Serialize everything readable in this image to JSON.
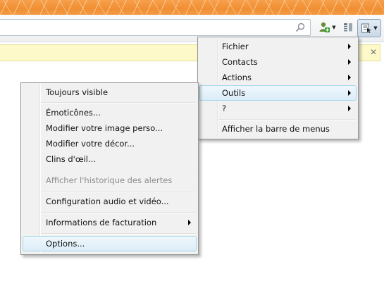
{
  "icons": {
    "search": "search-icon",
    "add_contact": "add-contact-icon",
    "layout": "layout-icon",
    "menu": "menu-icon"
  },
  "main_menu": {
    "items": [
      {
        "label": "Fichier",
        "submenu": true
      },
      {
        "label": "Contacts",
        "submenu": true
      },
      {
        "label": "Actions",
        "submenu": true
      },
      {
        "label": "Outils",
        "submenu": true,
        "highlighted": true
      },
      {
        "label": "?",
        "submenu": true
      },
      {
        "label": "Afficher la barre de menus",
        "submenu": false
      }
    ]
  },
  "tools_menu": {
    "items": [
      {
        "label": "Toujours visible"
      },
      {
        "label": "Émoticônes..."
      },
      {
        "label": "Modifier votre image perso..."
      },
      {
        "label": "Modifier votre décor..."
      },
      {
        "label": "Clins d'œil..."
      },
      {
        "label": "Afficher l'historique des alertes",
        "disabled": true
      },
      {
        "label": "Configuration audio et vidéo..."
      },
      {
        "label": "Informations de facturation",
        "submenu": true
      },
      {
        "label": "Options...",
        "highlighted": true
      }
    ]
  }
}
